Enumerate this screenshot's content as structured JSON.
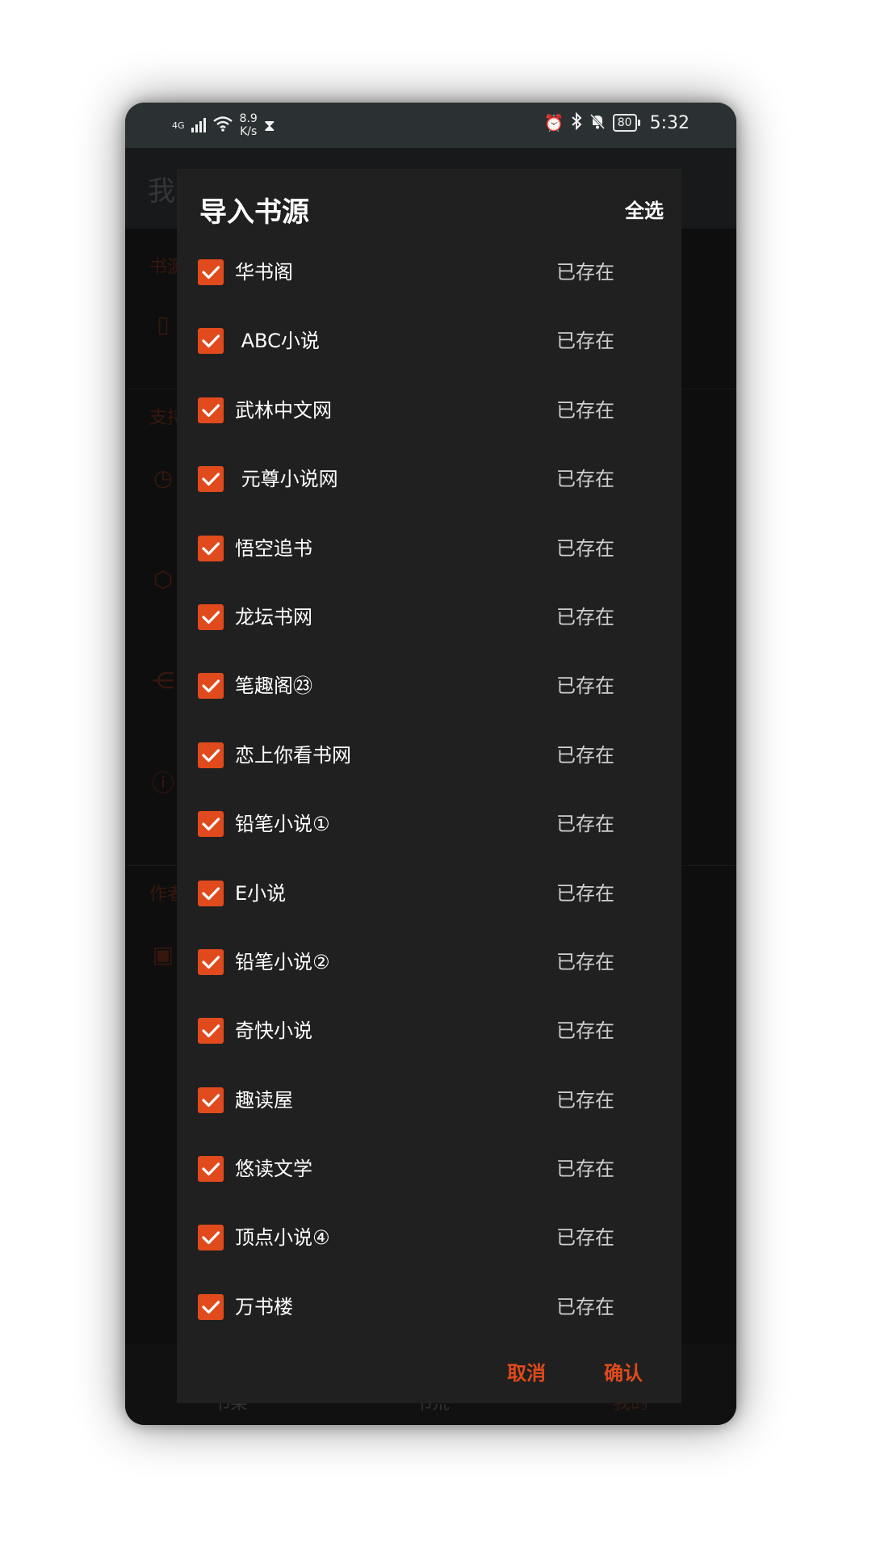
{
  "status_bar": {
    "network": "4G",
    "speed_value": "8.9",
    "speed_unit": "K/s",
    "battery": "80",
    "time": "5:32",
    "icons": [
      "signal-icon",
      "wifi-icon",
      "hourglass-icon",
      "alarm-icon",
      "bluetooth-icon",
      "bell-off-icon",
      "battery-icon"
    ]
  },
  "background_app": {
    "title": "我",
    "labels": [
      "书源",
      "支持",
      "作者"
    ],
    "bottom_nav": [
      "书架",
      "书荒",
      "我的"
    ]
  },
  "dialog": {
    "title": "导入书源",
    "select_all": "全选",
    "items": [
      {
        "name": "华书阁",
        "status": "已存在",
        "checked": true
      },
      {
        "name": " ABC小说",
        "status": "已存在",
        "checked": true
      },
      {
        "name": "武林中文网",
        "status": "已存在",
        "checked": true
      },
      {
        "name": " 元尊小说网",
        "status": "已存在",
        "checked": true
      },
      {
        "name": "悟空追书",
        "status": "已存在",
        "checked": true
      },
      {
        "name": "龙坛书网",
        "status": "已存在",
        "checked": true
      },
      {
        "name": "笔趣阁㉓",
        "status": "已存在",
        "checked": true
      },
      {
        "name": "恋上你看书网",
        "status": "已存在",
        "checked": true
      },
      {
        "name": "铅笔小说①",
        "status": "已存在",
        "checked": true
      },
      {
        "name": "E小说",
        "status": "已存在",
        "checked": true
      },
      {
        "name": "铅笔小说②",
        "status": "已存在",
        "checked": true
      },
      {
        "name": "奇快小说",
        "status": "已存在",
        "checked": true
      },
      {
        "name": "趣读屋",
        "status": "已存在",
        "checked": true
      },
      {
        "name": "悠读文学",
        "status": "已存在",
        "checked": true
      },
      {
        "name": "顶点小说④",
        "status": "已存在",
        "checked": true
      },
      {
        "name": "万书楼",
        "status": "已存在",
        "checked": true
      }
    ],
    "cancel": "取消",
    "confirm": "确认"
  },
  "colors": {
    "accent": "#e04a1c",
    "dialog_bg": "#202020",
    "status_bar_bg": "#2b3033"
  }
}
